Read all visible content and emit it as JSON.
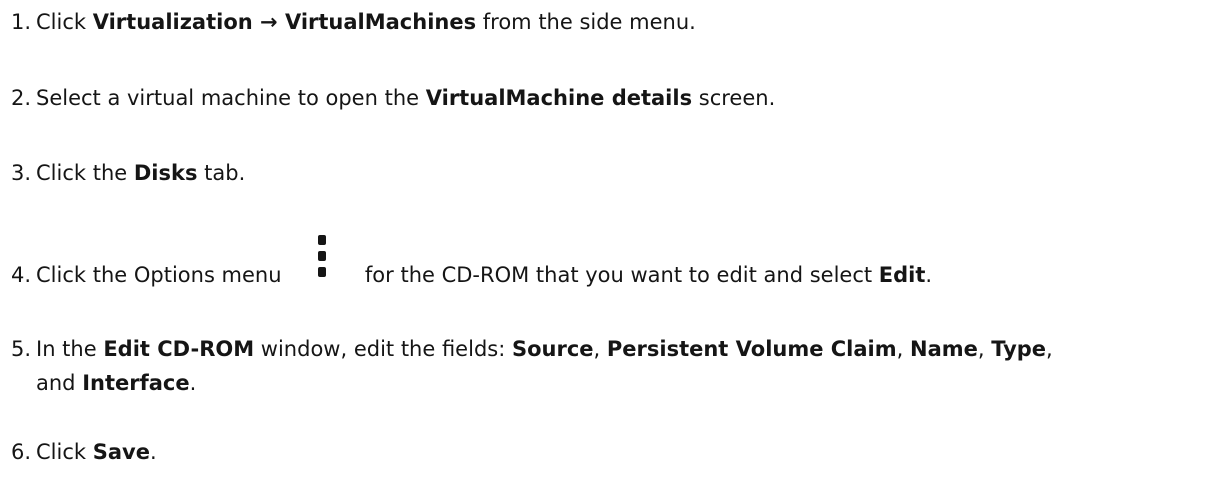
{
  "steps": [
    {
      "num": "1.",
      "t1": "Click ",
      "b1": "Virtualization → VirtualMachines",
      "t2": " from the side menu."
    },
    {
      "num": "2.",
      "t1": "Select a virtual machine to open the ",
      "b1": "VirtualMachine details",
      "t2": " screen."
    },
    {
      "num": "3.",
      "t1": "Click the ",
      "b1": "Disks",
      "t2": " tab."
    },
    {
      "num": "4.",
      "t1": "Click the Options menu ",
      "icon": "kebab-options-icon",
      "t2": " for the CD-ROM that you want to edit and select ",
      "b1": "Edit",
      "t3": "."
    },
    {
      "num": "5.",
      "t1": "In the ",
      "b1": "Edit CD-ROM",
      "t2": " window, edit the fields: ",
      "b2": "Source",
      "t3": ", ",
      "b3": "Persistent Volume Claim",
      "t4": ", ",
      "b4": "Name",
      "t5": ", ",
      "b5": "Type",
      "t6": ",",
      "t7": "and ",
      "b6": "Interface",
      "t8": "."
    },
    {
      "num": "6.",
      "t1": "Click ",
      "b1": "Save",
      "t2": "."
    }
  ]
}
